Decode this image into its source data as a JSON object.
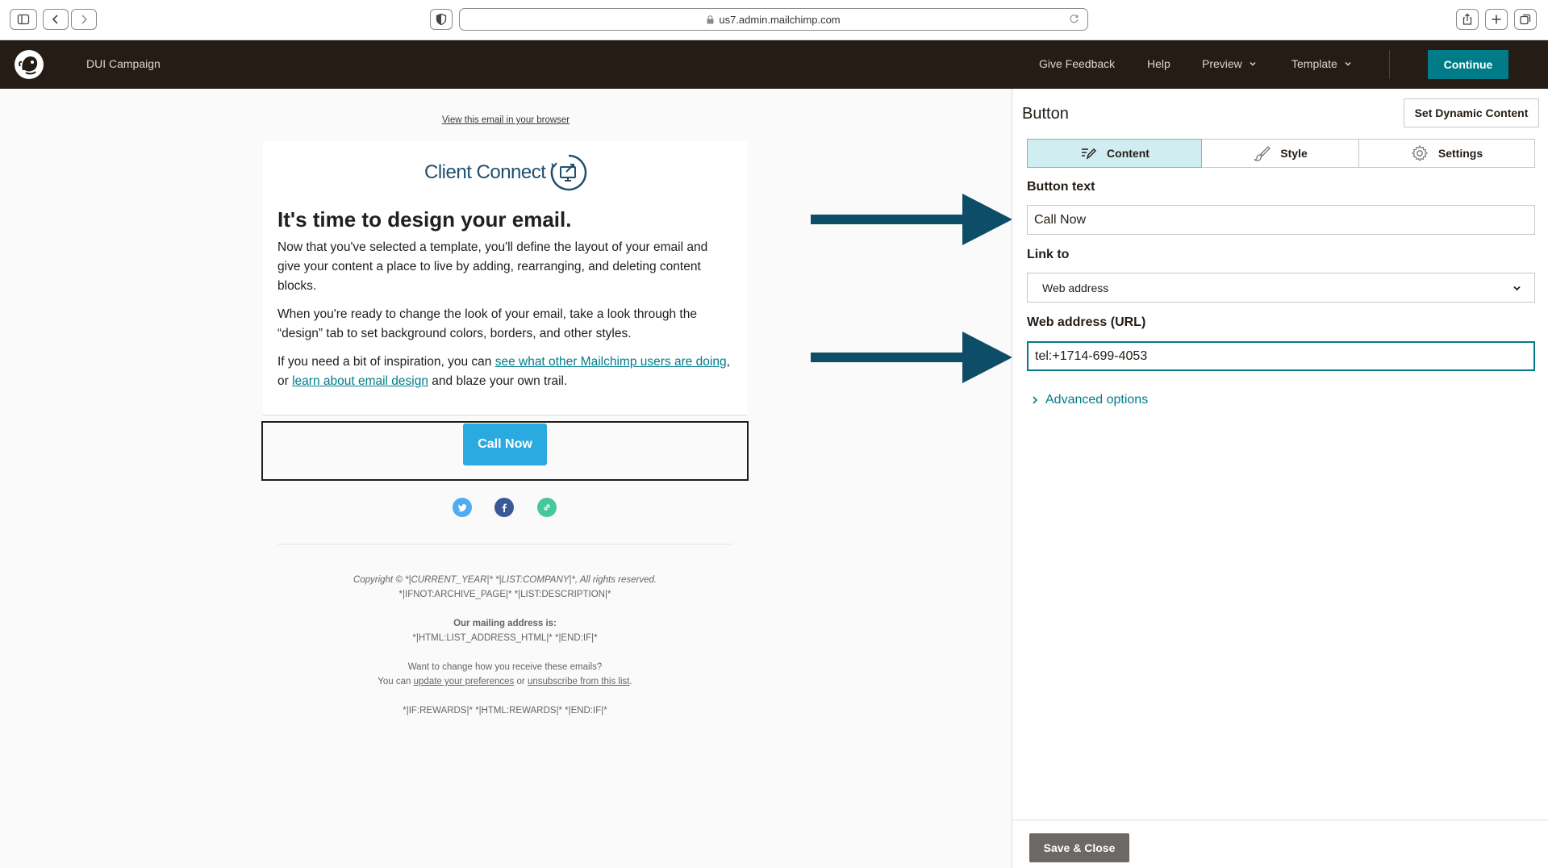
{
  "browser": {
    "url": "us7.admin.mailchimp.com"
  },
  "header": {
    "campaign_name": "DUI Campaign",
    "nav": {
      "feedback": "Give Feedback",
      "help": "Help",
      "preview": "Preview",
      "template": "Template"
    },
    "continue_label": "Continue",
    "accent": "#007c89"
  },
  "email": {
    "view_in_browser": "View this email in your browser",
    "brand_name": "Client Connect",
    "heading": "It's time to design your email.",
    "p1": "Now that you've selected a template, you'll define the layout of your email and give your content a place to live by adding, rearranging, and deleting content blocks.",
    "p2": "When you're ready to change the look of your email, take a look through the “design” tab to set background colors, borders, and other styles.",
    "p3_before": "If you need a bit of inspiration, you can ",
    "p3_link1": "see what other Mailchimp users are doing",
    "p3_middle": ", or ",
    "p3_link2": "learn about email design",
    "p3_after": " and blaze your own trail.",
    "button_label": "Call Now",
    "button_color": "#2baadf",
    "footer": {
      "copyright": "Copyright © *|CURRENT_YEAR|* *|LIST:COMPANY|*, All rights reserved.",
      "archive": "*|IFNOT:ARCHIVE_PAGE|* *|LIST:DESCRIPTION|*",
      "mailing_title": "Our mailing address is:",
      "mailing_value": "*|HTML:LIST_ADDRESS_HTML|* *|END:IF|*",
      "change_q": "Want to change how you receive these emails?",
      "you_can": "You can ",
      "update_prefs": "update your preferences",
      "or": " or ",
      "unsubscribe": "unsubscribe from this list",
      "period": ".",
      "rewards": "*|IF:REWARDS|* *|HTML:REWARDS|* *|END:IF|*"
    }
  },
  "panel": {
    "title": "Button",
    "dynamic_content": "Set Dynamic Content",
    "tabs": [
      {
        "label": "Content",
        "icon": "edit-icon",
        "active": true
      },
      {
        "label": "Style",
        "icon": "paint-brush-icon",
        "active": false
      },
      {
        "label": "Settings",
        "icon": "gear-icon",
        "active": false
      }
    ],
    "button_text_label": "Button text",
    "button_text_value": "Call Now",
    "link_to_label": "Link to",
    "link_to_value": "Web address",
    "url_label": "Web address (URL)",
    "url_value": "tel:+1714-699-4053",
    "advanced": "Advanced options",
    "save_close": "Save & Close"
  }
}
